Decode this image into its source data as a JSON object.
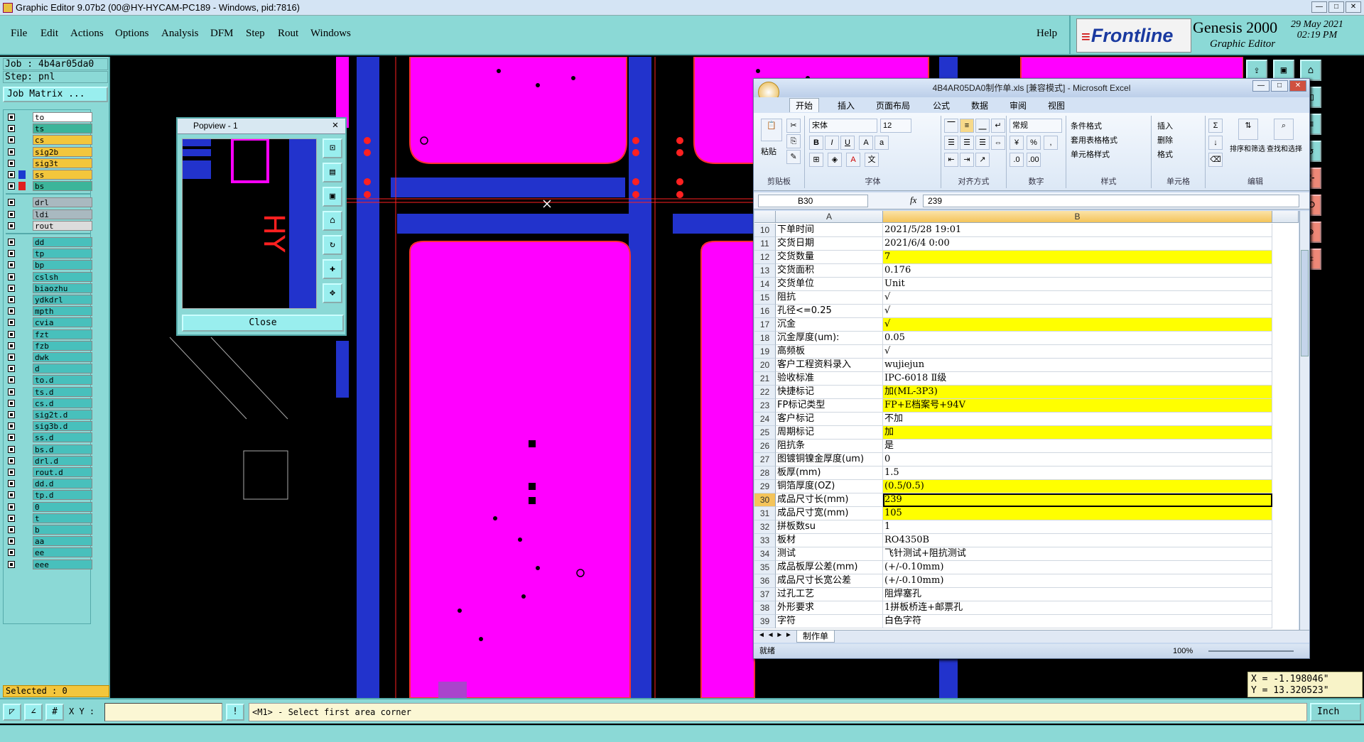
{
  "window": {
    "title": "Graphic Editor 9.07b2 (00@HY-HYCAM-PC189 - Windows, pid:7816)"
  },
  "menu": {
    "items": [
      "File",
      "Edit",
      "Actions",
      "Options",
      "Analysis",
      "DFM",
      "Step",
      "Rout",
      "Windows"
    ],
    "help": "Help"
  },
  "brand": {
    "logo": "Frontline",
    "product": "Genesis 2000",
    "subtitle": "Graphic Editor",
    "date": "29 May 2021",
    "time": "02:19 PM"
  },
  "job": {
    "job_label": "Job : 4b4ar05da0",
    "step_label": "Step: pnl",
    "matrix_button": "Job Matrix ...",
    "selected": "Selected : 0"
  },
  "layers": [
    {
      "name": "to",
      "color": "#ffffff"
    },
    {
      "name": "ts",
      "color": "#3cb59a"
    },
    {
      "name": "cs",
      "color": "#f3c63c"
    },
    {
      "name": "sig2b",
      "color": "#f3c63c"
    },
    {
      "name": "sig3t",
      "color": "#f3c63c"
    },
    {
      "name": "ss",
      "color": "#f3c63c"
    },
    {
      "name": "bs",
      "color": "#3cb59a"
    },
    {
      "name": "drl",
      "color": "#a9b9c0"
    },
    {
      "name": "ldi",
      "color": "#a9b9c0"
    },
    {
      "name": "rout",
      "color": "#dcdcdc"
    },
    {
      "name": "dd",
      "color": "#48c0bc"
    },
    {
      "name": "tp",
      "color": "#48c0bc"
    },
    {
      "name": "bp",
      "color": "#48c0bc"
    },
    {
      "name": "cslsh",
      "color": "#48c0bc"
    },
    {
      "name": "biaozhu",
      "color": "#48c0bc"
    },
    {
      "name": "ydkdrl",
      "color": "#48c0bc"
    },
    {
      "name": "mpth",
      "color": "#48c0bc"
    },
    {
      "name": "cvia",
      "color": "#48c0bc"
    },
    {
      "name": "fzt",
      "color": "#48c0bc"
    },
    {
      "name": "fzb",
      "color": "#48c0bc"
    },
    {
      "name": "dwk",
      "color": "#48c0bc"
    },
    {
      "name": "d",
      "color": "#48c0bc"
    },
    {
      "name": "to.d",
      "color": "#48c0bc"
    },
    {
      "name": "ts.d",
      "color": "#48c0bc"
    },
    {
      "name": "cs.d",
      "color": "#48c0bc"
    },
    {
      "name": "sig2t.d",
      "color": "#48c0bc"
    },
    {
      "name": "sig3b.d",
      "color": "#48c0bc"
    },
    {
      "name": "ss.d",
      "color": "#48c0bc"
    },
    {
      "name": "bs.d",
      "color": "#48c0bc"
    },
    {
      "name": "drl.d",
      "color": "#48c0bc"
    },
    {
      "name": "rout.d",
      "color": "#48c0bc"
    },
    {
      "name": "dd.d",
      "color": "#48c0bc"
    },
    {
      "name": "tp.d",
      "color": "#48c0bc"
    },
    {
      "name": "0",
      "color": "#48c0bc"
    },
    {
      "name": "t",
      "color": "#48c0bc"
    },
    {
      "name": "b",
      "color": "#48c0bc"
    },
    {
      "name": "aa",
      "color": "#48c0bc"
    },
    {
      "name": "ee",
      "color": "#48c0bc"
    },
    {
      "name": "eee",
      "color": "#48c0bc"
    }
  ],
  "popview": {
    "title": "Popview - 1",
    "close_x": "✕",
    "close_button": "Close"
  },
  "excel": {
    "title": "4B4AR05DA0制作单.xls [兼容模式] - Microsoft Excel",
    "tabs": [
      "开始",
      "插入",
      "页面布局",
      "公式",
      "数据",
      "审阅",
      "视图"
    ],
    "ribbon": {
      "paste": "粘贴",
      "clipboard": "剪贴板",
      "font_name": "宋体",
      "font_size": "12",
      "font_group": "字体",
      "align_group": "对齐方式",
      "number_format": "常规",
      "number_group": "数字",
      "cond_format": "条件格式",
      "table_format": "套用表格格式",
      "cell_style": "单元格样式",
      "style_group": "样式",
      "insert": "插入",
      "delete": "删除",
      "format": "格式",
      "cells_group": "单元格",
      "sort_filter": "排序和筛选",
      "find_select": "查找和选择",
      "edit_group": "编辑"
    },
    "namebox": "B30",
    "fx": "fx",
    "formula_value": "239",
    "col_a": "A",
    "col_b": "B",
    "rows": [
      {
        "n": "10",
        "a": "下单时间",
        "b": "2021/5/28 19:01",
        "hl": false
      },
      {
        "n": "11",
        "a": "交货日期",
        "b": "2021/6/4 0:00",
        "hl": false
      },
      {
        "n": "12",
        "a": "交货数量",
        "b": "7",
        "hl": true
      },
      {
        "n": "13",
        "a": "交货面积",
        "b": "0.176",
        "hl": false
      },
      {
        "n": "14",
        "a": "交货单位",
        "b": "Unit",
        "hl": false
      },
      {
        "n": "15",
        "a": "阻抗",
        "b": "√",
        "hl": false
      },
      {
        "n": "16",
        "a": "孔径<=0.25",
        "b": "√",
        "hl": false
      },
      {
        "n": "17",
        "a": "沉金",
        "b": "√",
        "hl": true
      },
      {
        "n": "18",
        "a": "沉金厚度(um):",
        "b": "0.05",
        "hl": false
      },
      {
        "n": "19",
        "a": "高频板",
        "b": "√",
        "hl": false
      },
      {
        "n": "20",
        "a": "客户工程资料录入",
        "b": "wujiejun",
        "hl": false
      },
      {
        "n": "21",
        "a": "验收标准",
        "b": "IPC-6018 Ⅱ级",
        "hl": false
      },
      {
        "n": "22",
        "a": "快捷标记",
        "b": "加(ML-3P3)",
        "hl": true
      },
      {
        "n": "23",
        "a": "FP标记类型",
        "b": "FP+E档案号+94V",
        "hl": true
      },
      {
        "n": "24",
        "a": "客户标记",
        "b": "不加",
        "hl": false
      },
      {
        "n": "25",
        "a": "周期标记",
        "b": "加",
        "hl": true
      },
      {
        "n": "26",
        "a": "阻抗条",
        "b": "是",
        "hl": false
      },
      {
        "n": "27",
        "a": "图镀铜镍金厚度(um)",
        "b": "0",
        "hl": false
      },
      {
        "n": "28",
        "a": "板厚(mm)",
        "b": "1.5",
        "hl": false
      },
      {
        "n": "29",
        "a": "铜箔厚度(OZ)",
        "b": "(0.5/0.5)",
        "hl": true
      },
      {
        "n": "30",
        "a": "成品尺寸长(mm)",
        "b": "239",
        "hl": true
      },
      {
        "n": "31",
        "a": "成品尺寸宽(mm)",
        "b": "105",
        "hl": true
      },
      {
        "n": "32",
        "a": "拼板数su",
        "b": "1",
        "hl": false
      },
      {
        "n": "33",
        "a": "板材",
        "b": "RO4350B",
        "hl": false
      },
      {
        "n": "34",
        "a": "测试",
        "b": "飞针测试+阻抗测试",
        "hl": false
      },
      {
        "n": "35",
        "a": "成品板厚公差(mm)",
        "b": "(+/-0.10mm)",
        "hl": false
      },
      {
        "n": "36",
        "a": "成品尺寸长宽公差",
        "b": "(+/-0.10mm)",
        "hl": false
      },
      {
        "n": "37",
        "a": "过孔工艺",
        "b": "阻焊塞孔",
        "hl": false
      },
      {
        "n": "38",
        "a": "外形要求",
        "b": "1拼板桥连+邮票孔",
        "hl": false
      },
      {
        "n": "39",
        "a": "字符",
        "b": "白色字符",
        "hl": false
      }
    ],
    "sheet_tab": "制作单",
    "status_ready": "就绪",
    "zoom": "100%"
  },
  "coords": {
    "x": "X = -1.198046\"",
    "y": "Y = 13.320523\""
  },
  "cmd": {
    "xy_label": "X Y :",
    "prompt": "<M1> - Select first area corner",
    "units": "Inch"
  }
}
